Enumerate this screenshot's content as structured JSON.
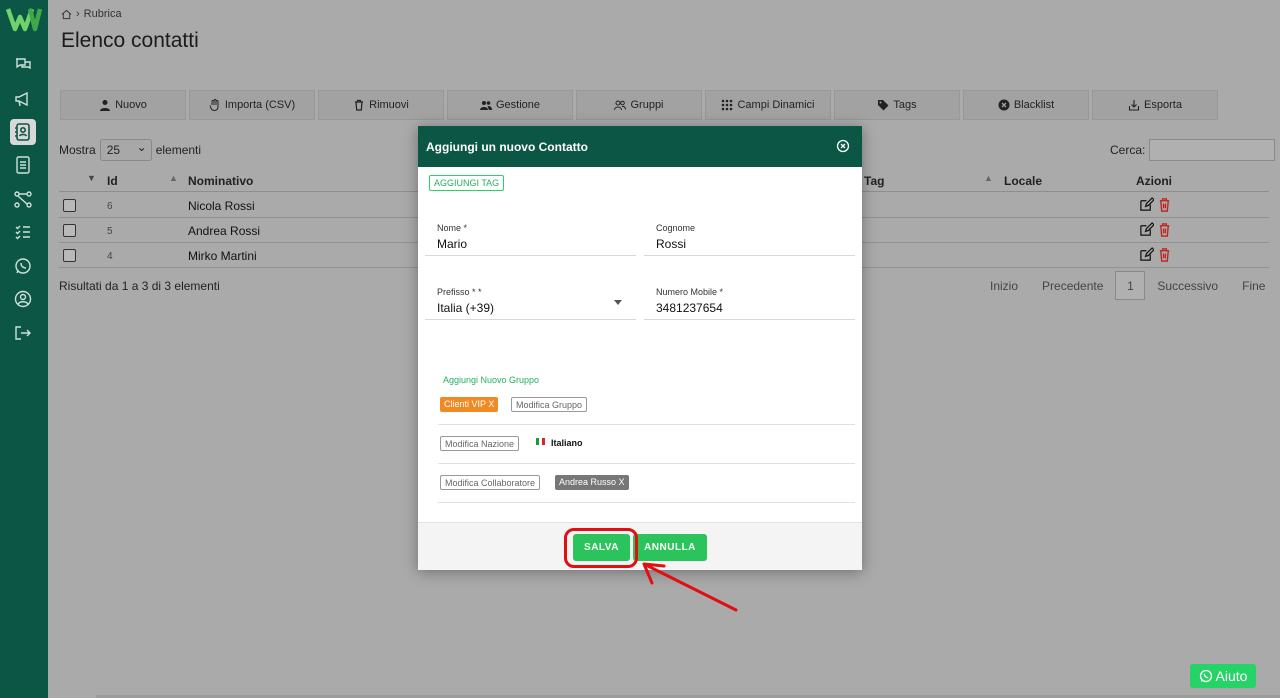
{
  "breadcrumb": {
    "home_icon": "home-icon",
    "label": "Rubrica"
  },
  "page_title": "Elenco contatti",
  "toolbar": [
    {
      "label": "Nuovo",
      "icon": "user-icon"
    },
    {
      "label": "Importa (CSV)",
      "icon": "hand-icon"
    },
    {
      "label": "Rimuovi",
      "icon": "trash-icon"
    },
    {
      "label": "Gestione",
      "icon": "users-icon"
    },
    {
      "label": "Gruppi",
      "icon": "group-icon"
    },
    {
      "label": "Campi Dinamici",
      "icon": "grid-icon"
    },
    {
      "label": "Tags",
      "icon": "tag-icon"
    },
    {
      "label": "Blacklist",
      "icon": "ban-icon"
    },
    {
      "label": "Esporta",
      "icon": "export-icon"
    }
  ],
  "table_controls": {
    "show_label": "Mostra",
    "page_size": "25",
    "elements_label": "elementi",
    "search_label": "Cerca:",
    "search_value": ""
  },
  "table": {
    "columns": [
      "Id",
      "Nominativo",
      "Tag",
      "Locale",
      "Azioni"
    ],
    "rows": [
      {
        "id": "6",
        "name": "Nicola Rossi"
      },
      {
        "id": "5",
        "name": "Andrea Rossi"
      },
      {
        "id": "4",
        "name": "Mirko Martini"
      }
    ]
  },
  "results_text": "Risultati da 1 a 3 di 3 elementi",
  "pagination": {
    "first": "Inizio",
    "prev": "Precedente",
    "current": "1",
    "next": "Successivo",
    "last": "Fine"
  },
  "help_button": "Aiuto",
  "modal": {
    "title": "Aggiungi un nuovo Contatto",
    "add_tag": "AGGIUNGI TAG",
    "fields": {
      "nome": {
        "label": "Nome *",
        "value": "Mario"
      },
      "cognome": {
        "label": "Cognome",
        "value": "Rossi"
      },
      "prefisso": {
        "label": "Prefisso * *",
        "value": "Italia (+39)"
      },
      "mobile": {
        "label": "Numero Mobile *",
        "value": "3481237654"
      }
    },
    "group_title": "Aggiungi Nuovo Gruppo",
    "group_badge": "Clienti VIP  X",
    "edit_group": "Modifica Gruppo",
    "edit_nation": "Modifica Nazione",
    "nation": "Italiano",
    "edit_collaborator": "Modifica Collaboratore",
    "collaborator_badge": "Andrea Russo  X",
    "save": "SALVA",
    "cancel": "ANNULLA"
  },
  "colors": {
    "brand": "#0c5646",
    "accent": "#25d366",
    "highlight": "#e01010",
    "orange": "#f08a24"
  }
}
